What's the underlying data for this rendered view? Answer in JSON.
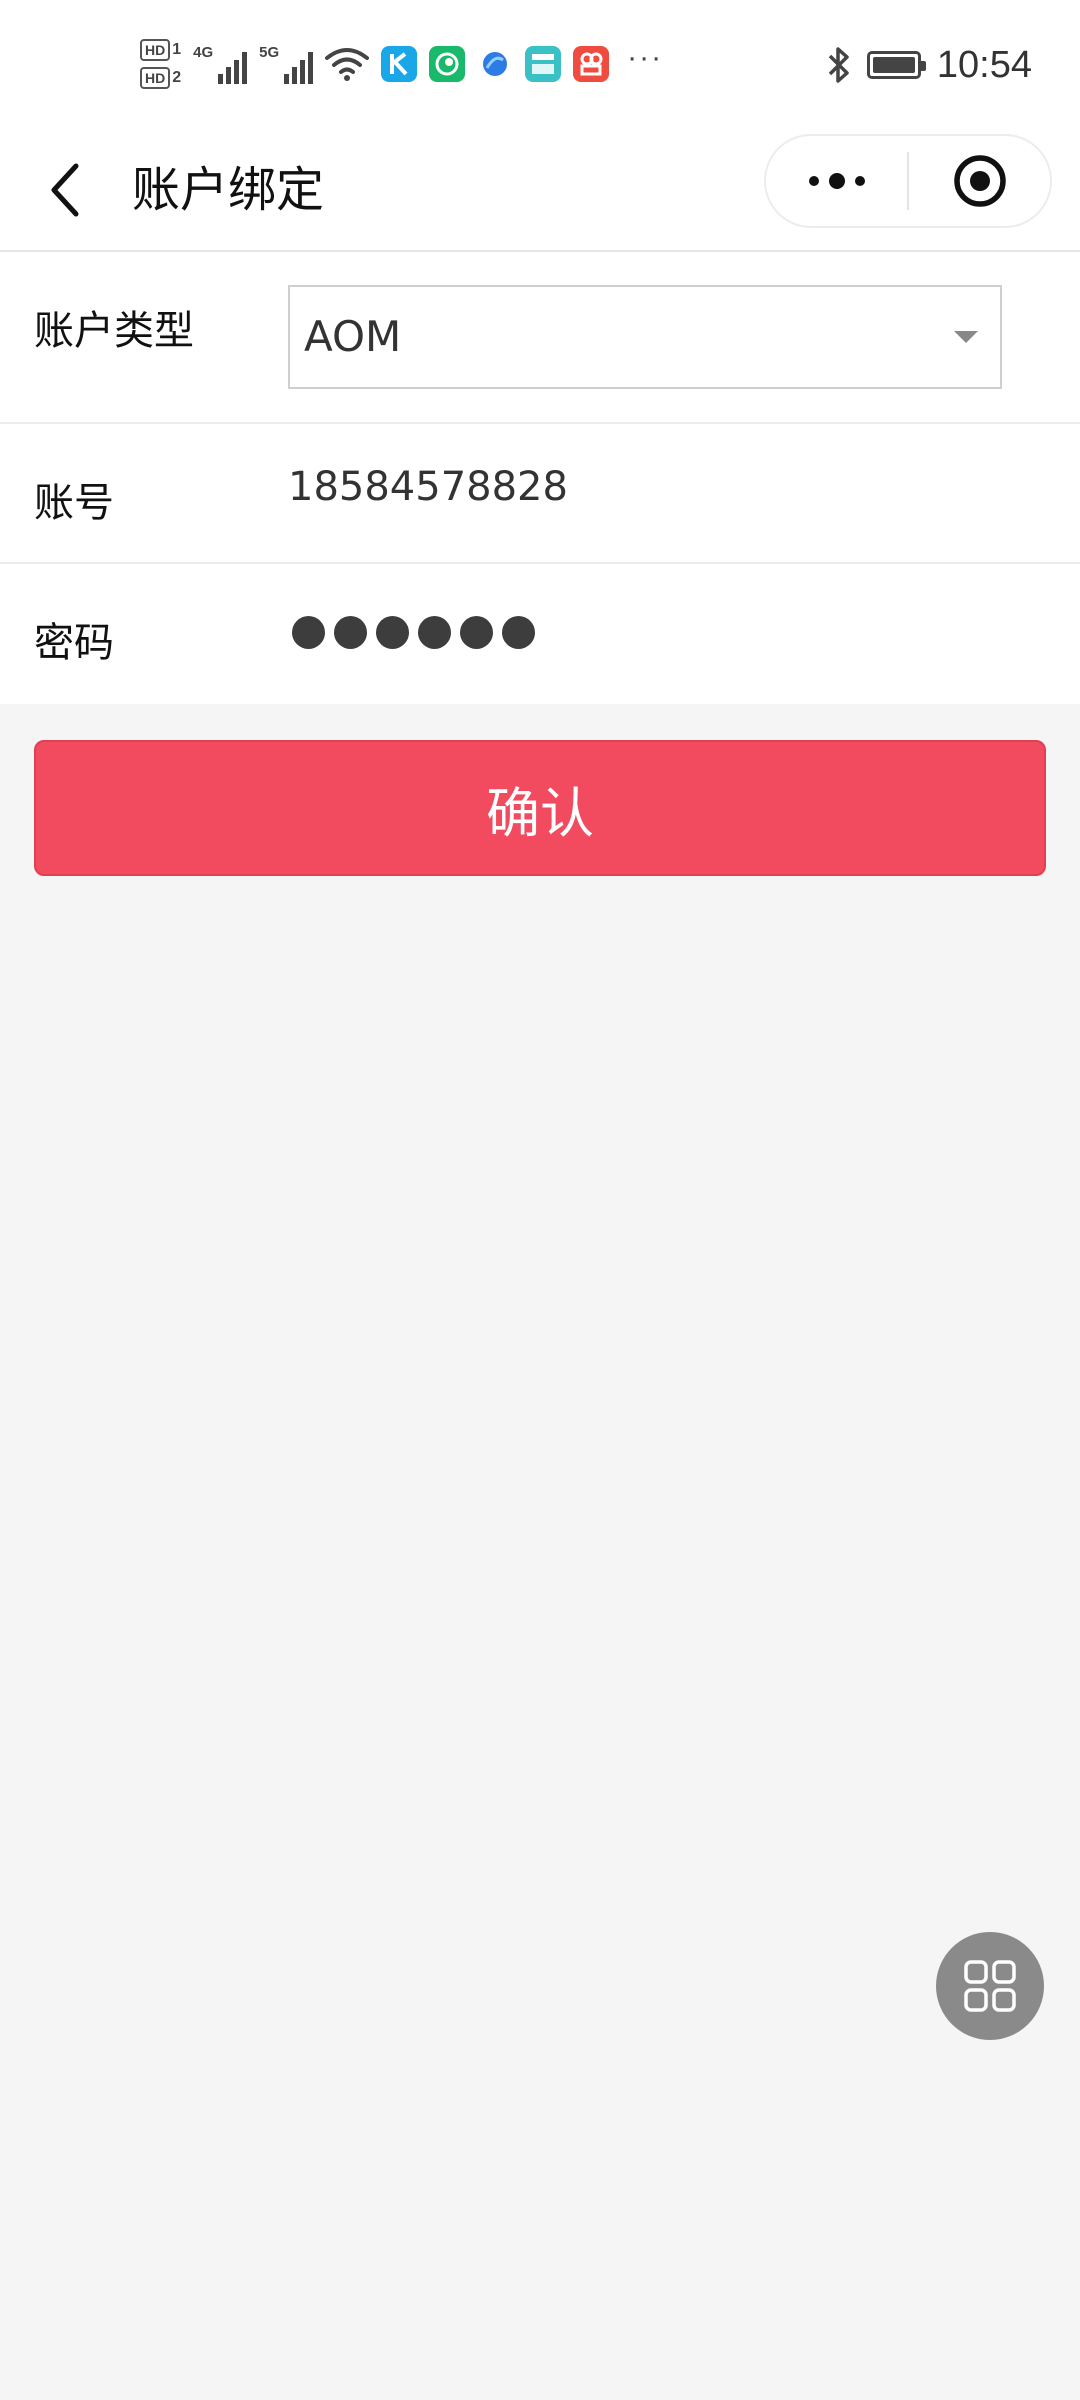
{
  "status_bar": {
    "sim1_label": "HD",
    "sim1_index": "1",
    "sim2_label": "HD",
    "sim2_index": "2",
    "network1": "4G",
    "network2": "5G",
    "more": "···",
    "time": "10:54",
    "icons": [
      "wifi-icon",
      "kuaishou-k-icon",
      "green-app-icon",
      "blue-app-icon",
      "boss-zhipin-icon",
      "red-app-icon",
      "bluetooth-icon",
      "battery-icon"
    ]
  },
  "nav": {
    "title": "账户绑定",
    "back_icon": "chevron-left-icon",
    "more_icon": "more-dots-icon",
    "close_icon": "target-circle-icon"
  },
  "form": {
    "account_type_label": "账户类型",
    "account_type_value": "AOM",
    "account_label": "账号",
    "account_value": "18584578828",
    "password_label": "密码",
    "password_dot_count": 6
  },
  "confirm_label": "确认",
  "floating_icon": "grid-apps-icon",
  "colors": {
    "accent": "#f24a5e",
    "background": "#f5f5f5",
    "float_button": "#8a8a8a"
  }
}
